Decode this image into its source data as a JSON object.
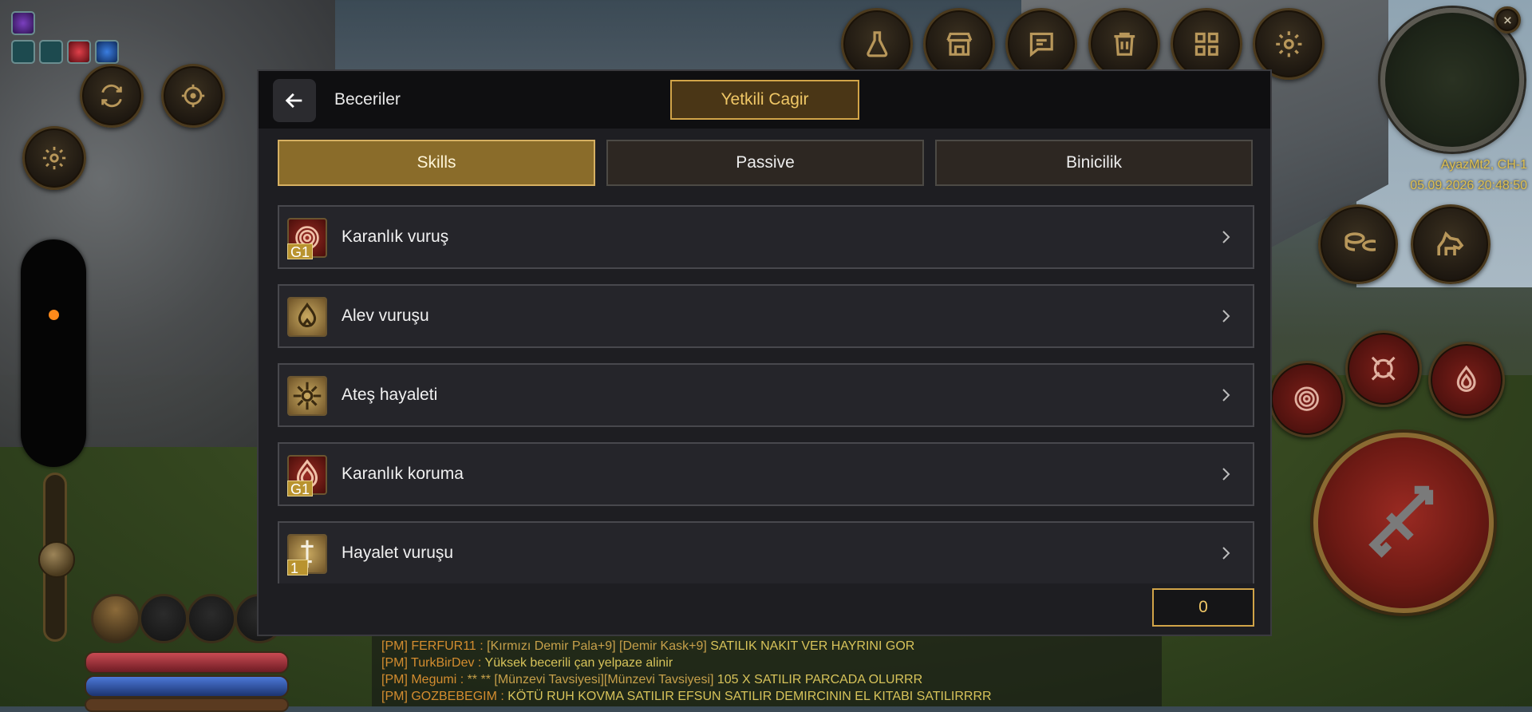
{
  "modal": {
    "title": "Beceriler",
    "gm_button": "Yetkili Cagir",
    "tabs": [
      {
        "label": "Skills",
        "active": true
      },
      {
        "label": "Passive",
        "active": false
      },
      {
        "label": "Binicilik",
        "active": false
      }
    ],
    "skills": [
      {
        "name": "Karanlık vuruş",
        "badge": "G1",
        "icon": "dark-strike-icon"
      },
      {
        "name": "Alev vuruşu",
        "badge": "",
        "icon": "flame-strike-icon"
      },
      {
        "name": "Ateş hayaleti",
        "badge": "",
        "icon": "fire-ghost-icon"
      },
      {
        "name": "Karanlık koruma",
        "badge": "G1",
        "icon": "dark-protection-icon"
      },
      {
        "name": "Hayalet vuruşu",
        "badge": "1",
        "icon": "ghost-strike-icon"
      }
    ],
    "skill_points": "0"
  },
  "minimap": {
    "location": "AyazMt2, CH-1",
    "datetime": "05.09.2026 20:48:50"
  },
  "chat": [
    {
      "prefix": "[PM] FERFUR11 : ",
      "item": "[Kırmızı Demir Pala+9] [Demir Kask+9]",
      "text": " SATILIK NAKIT VER HAYRINI GOR"
    },
    {
      "prefix": "[PM] TurkBirDev : ",
      "item": "",
      "text": "Yüksek becerili çan yelpaze alinir"
    },
    {
      "prefix": "[PM] Megumi : ",
      "item": " **  ** [Münzevi Tavsiyesi][Münzevi Tavsiyesi]",
      "text": " 105 X SATILIR PARCADA OLURRR"
    },
    {
      "prefix": "[PM] GOZBEBEGIM : ",
      "item": "",
      "text": " KÖTÜ RUH KOVMA SATILIR EFSUN SATILIR DEMIRCININ EL KITABI SATILIRRRR"
    }
  ],
  "hud": {
    "top_buttons": [
      "potion-flask-icon",
      "shop-icon",
      "chat-icon",
      "trash-icon",
      "grid-menu-icon",
      "settings-gear-icon"
    ],
    "accent_color": "#d1a448",
    "joystick_dot_color": "#ff8a1a"
  }
}
